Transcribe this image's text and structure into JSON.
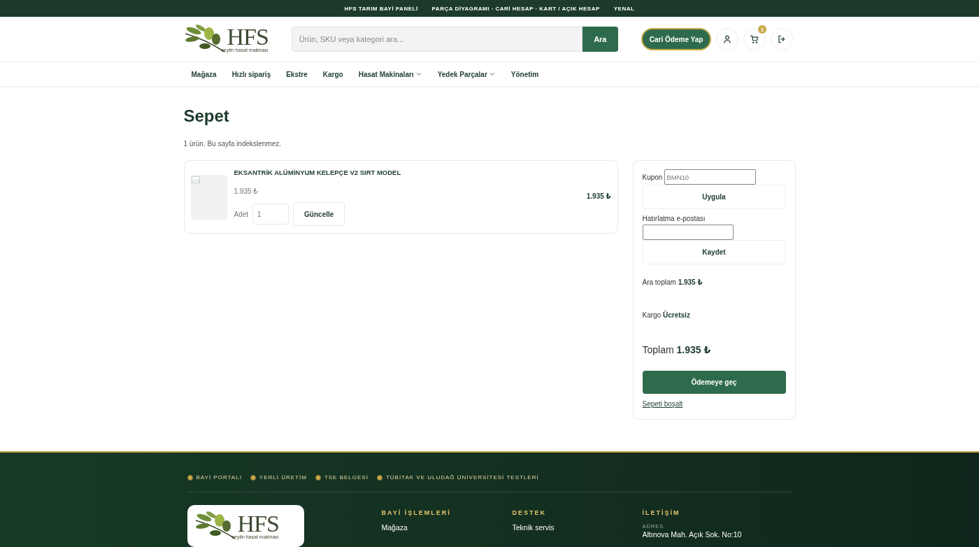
{
  "topbar": {
    "items": [
      "HFS TARIM BAYİ PANELİ",
      "PARÇA DİYAGRAMI · CARİ HESAP · KART / AÇIK HESAP",
      "YENAL"
    ]
  },
  "header": {
    "logo": {
      "title": "HFS",
      "subtitle": "zeytin hasat makinası"
    },
    "search": {
      "placeholder": "Ürün, SKU veya kategori ara...",
      "button": "Ara"
    },
    "pay_button": "Cari Ödeme Yap",
    "cart_count": "1"
  },
  "nav": [
    {
      "label": "Mağaza",
      "dropdown": false
    },
    {
      "label": "Hızlı sipariş",
      "dropdown": false
    },
    {
      "label": "Ekstre",
      "dropdown": false
    },
    {
      "label": "Kargo",
      "dropdown": false
    },
    {
      "label": "Hasat Makinaları",
      "dropdown": true
    },
    {
      "label": "Yedek Parçalar",
      "dropdown": true
    },
    {
      "label": "Yönetim",
      "dropdown": false
    }
  ],
  "page": {
    "title": "Sepet",
    "subtitle": "1 ürün. Bu sayfa indekslenmez."
  },
  "cart_items": [
    {
      "name": "EKSANTRİK ALÜMİNYUM KELEPÇE V2 SIRT MODEL",
      "unit_price": "1.935 ₺",
      "quantity_label": "Adet",
      "quantity": "1",
      "update_button": "Güncelle",
      "line_total": "1.935 ₺"
    }
  ],
  "summary": {
    "coupon_label": "Kupon",
    "coupon_value": "BMN10",
    "apply_button": "Uygula",
    "email_label": "Hatırlatma e-postası",
    "save_button": "Kaydet",
    "subtotal_label": "Ara toplam",
    "subtotal": "1.935 ₺",
    "shipping_label": "Kargo",
    "shipping": "Ücretsiz",
    "total_label": "Toplam",
    "total": "1.935 ₺",
    "checkout_button": "Ödemeye geç",
    "clear_link": "Sepeti boşalt"
  },
  "footer": {
    "badges": [
      "BAYİ PORTALI",
      "YERLİ ÜRETİM",
      "TSE BELGESİ",
      "TÜBİTAK VE ULUDAĞ ÜNİVERSİTESİ TESTLERİ"
    ],
    "logo": {
      "title": "HFS",
      "subtitle": "zeytin hasat makinası"
    },
    "columns": [
      {
        "kind": "links",
        "heading": "BAYİ İŞLEMLERİ",
        "links": [
          "Mağaza"
        ]
      },
      {
        "kind": "links",
        "heading": "DESTEK",
        "links": [
          "Teknik servis"
        ]
      },
      {
        "kind": "contact",
        "heading": "İLETİŞİM",
        "label": "ADRES",
        "text": "Altınova Mah. Açık Sok. No:10"
      }
    ]
  }
}
